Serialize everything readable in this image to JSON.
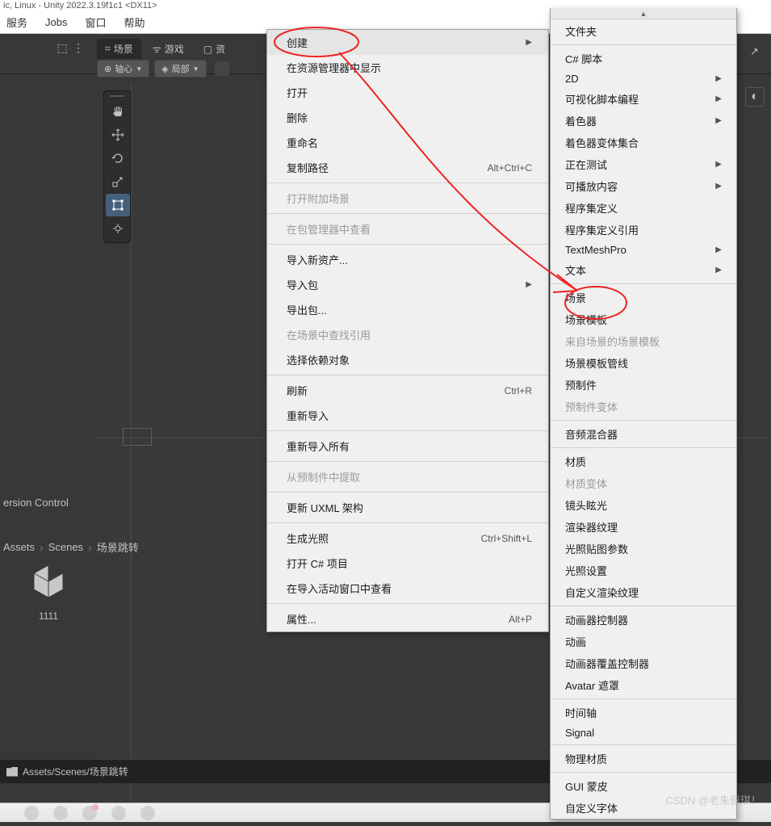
{
  "title_fragment": "ic, Linux - Unity 2022.3.19f1c1 <DX11>",
  "menu": {
    "items": [
      "服务",
      "Jobs",
      "窗口",
      "帮助"
    ]
  },
  "tabs": {
    "scene": "场景",
    "game": "游戏",
    "asset": "资"
  },
  "ribbon": {
    "pivot": "轴心",
    "local": "局部"
  },
  "version_control": "ersion Control",
  "breadcrumb": {
    "seg0": "Assets",
    "seg1": "Scenes",
    "seg2": "场景跳转"
  },
  "asset": {
    "name": "1111"
  },
  "status": {
    "path": "Assets/Scenes/场景跳转"
  },
  "context_menu": [
    {
      "label": "创建",
      "arrow": true,
      "hover": true
    },
    {
      "label": "在资源管理器中显示"
    },
    {
      "label": "打开"
    },
    {
      "label": "删除"
    },
    {
      "label": "重命名"
    },
    {
      "label": "复制路径",
      "shortcut": "Alt+Ctrl+C"
    },
    {
      "sep": true
    },
    {
      "label": "打开附加场景",
      "disabled": true
    },
    {
      "sep": true
    },
    {
      "label": "在包管理器中查看",
      "disabled": true
    },
    {
      "sep": true
    },
    {
      "label": "导入新资产..."
    },
    {
      "label": "导入包",
      "arrow": true
    },
    {
      "label": "导出包..."
    },
    {
      "label": "在场景中查找引用",
      "disabled": true
    },
    {
      "label": "选择依赖对象"
    },
    {
      "sep": true
    },
    {
      "label": "刷新",
      "shortcut": "Ctrl+R"
    },
    {
      "label": "重新导入"
    },
    {
      "sep": true
    },
    {
      "label": "重新导入所有"
    },
    {
      "sep": true
    },
    {
      "label": "从预制件中提取",
      "disabled": true
    },
    {
      "sep": true
    },
    {
      "label": "更新 UXML 架构"
    },
    {
      "sep": true
    },
    {
      "label": "生成光照",
      "shortcut": "Ctrl+Shift+L"
    },
    {
      "label": "打开 C# 项目"
    },
    {
      "label": "在导入活动窗口中查看"
    },
    {
      "sep": true
    },
    {
      "label": "属性...",
      "shortcut": "Alt+P"
    }
  ],
  "submenu": [
    {
      "label": "文件夹"
    },
    {
      "sep": true
    },
    {
      "label": "C# 脚本"
    },
    {
      "label": "2D",
      "arrow": true
    },
    {
      "label": "可视化脚本编程",
      "arrow": true
    },
    {
      "label": "着色器",
      "arrow": true
    },
    {
      "label": "着色器变体集合"
    },
    {
      "label": "正在测试",
      "arrow": true
    },
    {
      "label": "可播放内容",
      "arrow": true
    },
    {
      "label": "程序集定义"
    },
    {
      "label": "程序集定义引用"
    },
    {
      "label": "TextMeshPro",
      "arrow": true
    },
    {
      "label": "文本",
      "arrow": true
    },
    {
      "sep": true
    },
    {
      "label": "场景"
    },
    {
      "label": "场景模板"
    },
    {
      "label": "来自场景的场景模板",
      "disabled": true
    },
    {
      "label": "场景模板管线"
    },
    {
      "label": "预制件"
    },
    {
      "label": "预制件变体",
      "disabled": true
    },
    {
      "sep": true
    },
    {
      "label": "音频混合器"
    },
    {
      "sep": true
    },
    {
      "label": "材质"
    },
    {
      "label": "材质变体",
      "disabled": true
    },
    {
      "label": "镜头眩光"
    },
    {
      "label": "渲染器纹理"
    },
    {
      "label": "光照贴图参数"
    },
    {
      "label": "光照设置"
    },
    {
      "label": "自定义渲染纹理"
    },
    {
      "sep": true
    },
    {
      "label": "动画器控制器"
    },
    {
      "label": "动画"
    },
    {
      "label": "动画器覆盖控制器"
    },
    {
      "label": "Avatar 遮罩"
    },
    {
      "sep": true
    },
    {
      "label": "时间轴"
    },
    {
      "label": "Signal"
    },
    {
      "sep": true
    },
    {
      "label": "物理材质"
    },
    {
      "sep": true
    },
    {
      "label": "GUI 蒙皮"
    },
    {
      "label": "自定义字体"
    }
  ],
  "watermark": "CSDN @老朱佩琪！"
}
